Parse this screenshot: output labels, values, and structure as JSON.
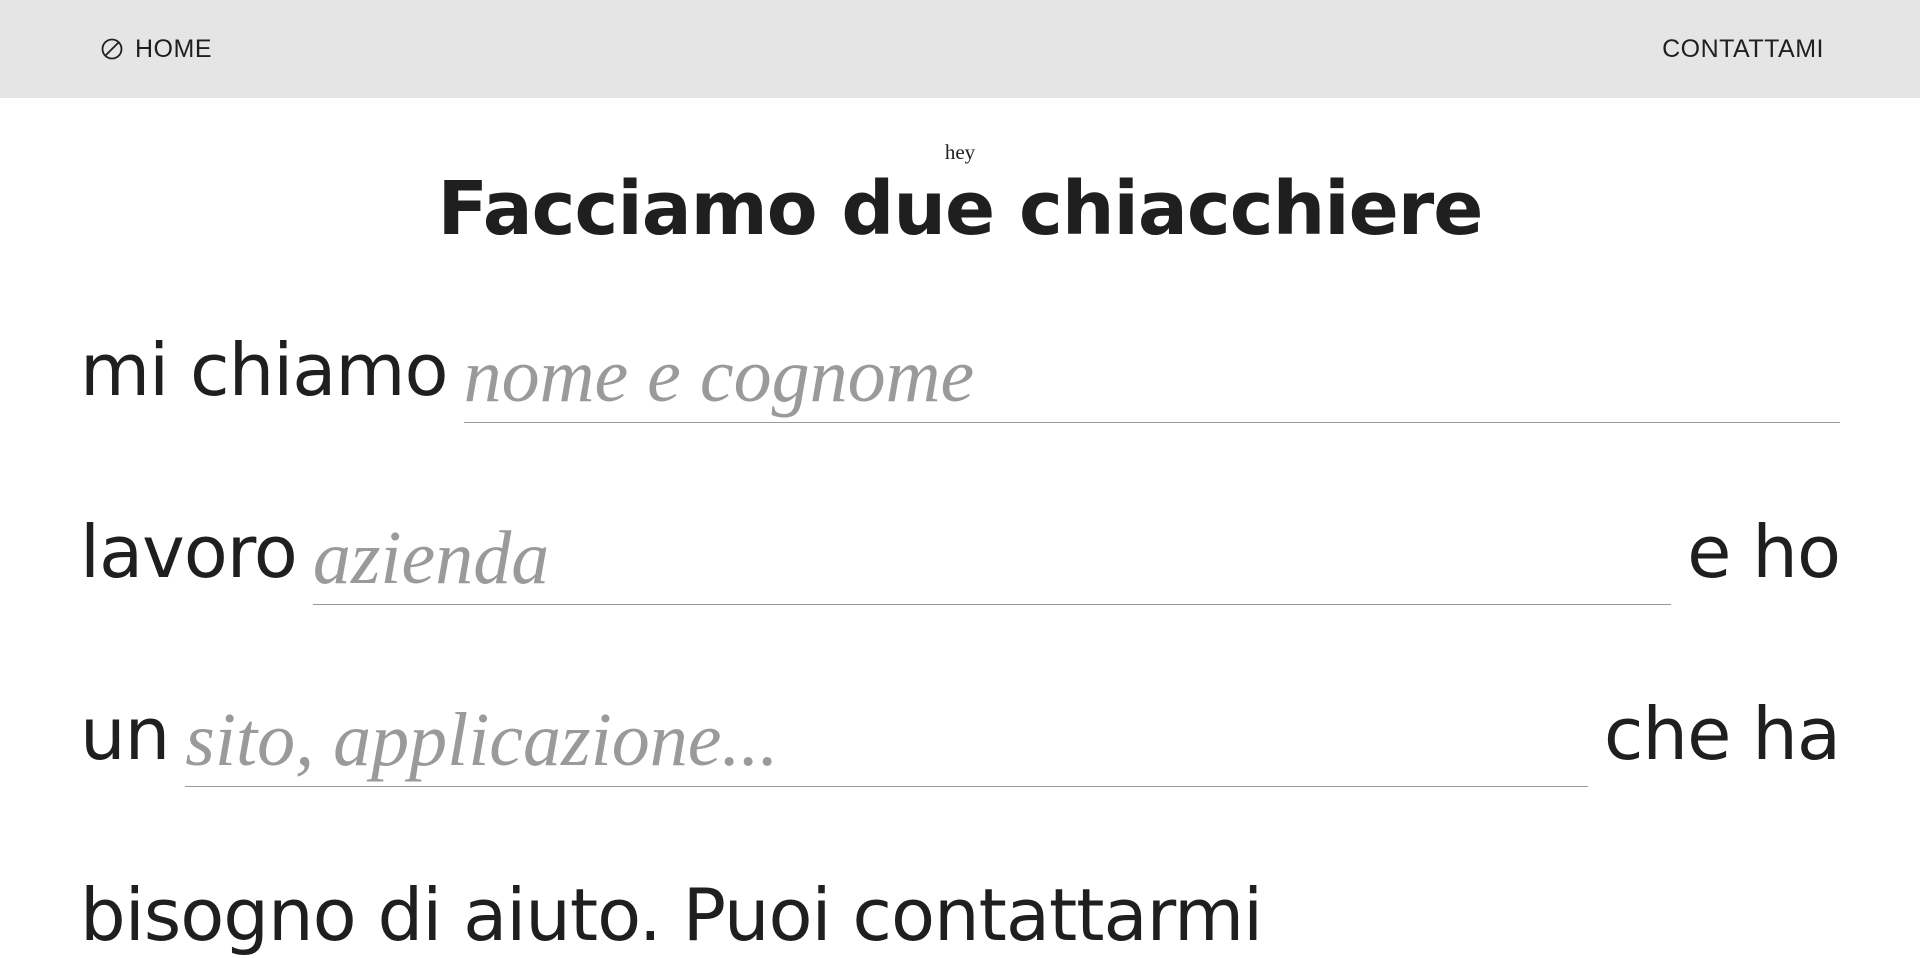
{
  "nav": {
    "home_label": "HOME",
    "home_icon": "circle-slash-icon",
    "contact_label": "CONTATTAMI"
  },
  "header": {
    "eyebrow": "hey",
    "title": "Facciamo due chiacchiere"
  },
  "form": {
    "line1": {
      "prefix": "mi chiamo",
      "placeholder": "nome e cognome",
      "suffix": ""
    },
    "line2": {
      "prefix": "lavoro",
      "placeholder": "azienda",
      "suffix": "e ho"
    },
    "line3": {
      "prefix": "un",
      "placeholder": "sito, applicazione...",
      "suffix": "che ha"
    },
    "line4": "bisogno di aiuto. Puoi contattarmi"
  },
  "colors": {
    "topbar": "#e5e5e5",
    "text": "#1f1f1f",
    "placeholder": "#9a9a9a"
  }
}
